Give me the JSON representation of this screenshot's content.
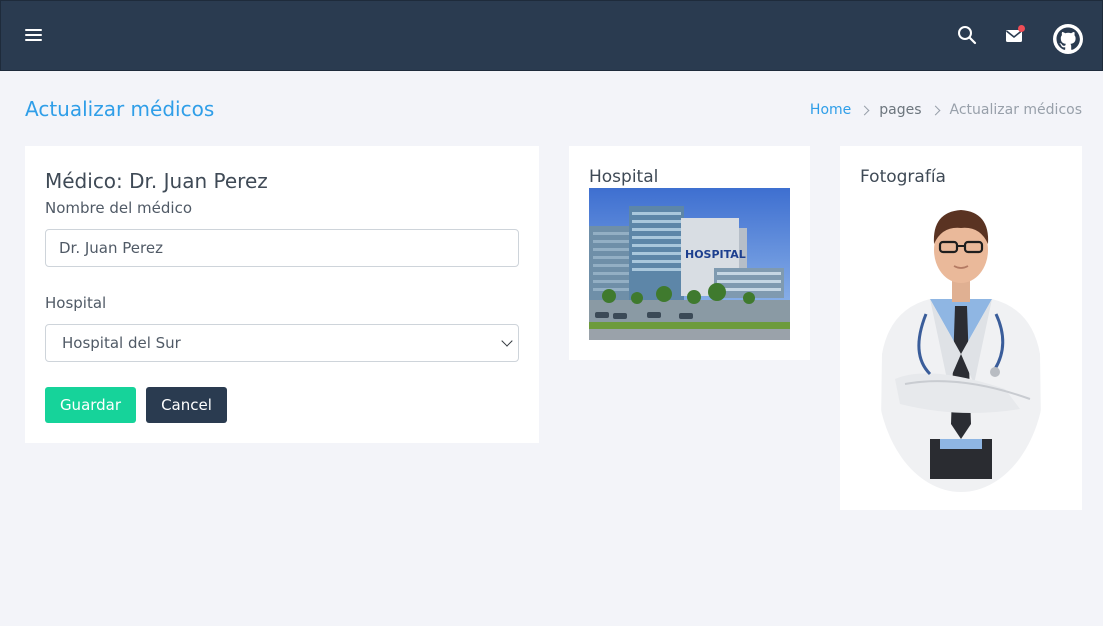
{
  "topbar": {
    "menu_icon": "hamburger-icon",
    "search_icon": "search-icon",
    "mail_icon": "mail-icon",
    "github_icon": "github-icon"
  },
  "page": {
    "title": "Actualizar médicos"
  },
  "breadcrumb": {
    "home": "Home",
    "pages": "pages",
    "current": "Actualizar médicos"
  },
  "form": {
    "title": "Médico: Dr. Juan Perez",
    "name_label": "Nombre del médico",
    "name_value": "Dr. Juan Perez",
    "hospital_label": "Hospital",
    "hospital_selected": "Hospital del Sur",
    "save_label": "Guardar",
    "cancel_label": "Cancel"
  },
  "hospital_card": {
    "title": "Hospital",
    "image_sign": "HOSPITAL"
  },
  "photo_card": {
    "title": "Fotografía"
  },
  "colors": {
    "topbar": "#2a3b50",
    "accent": "#2f9ee8",
    "save_button": "#16d39a",
    "cancel_button": "#2a3b50",
    "notification": "#ef4d56"
  }
}
